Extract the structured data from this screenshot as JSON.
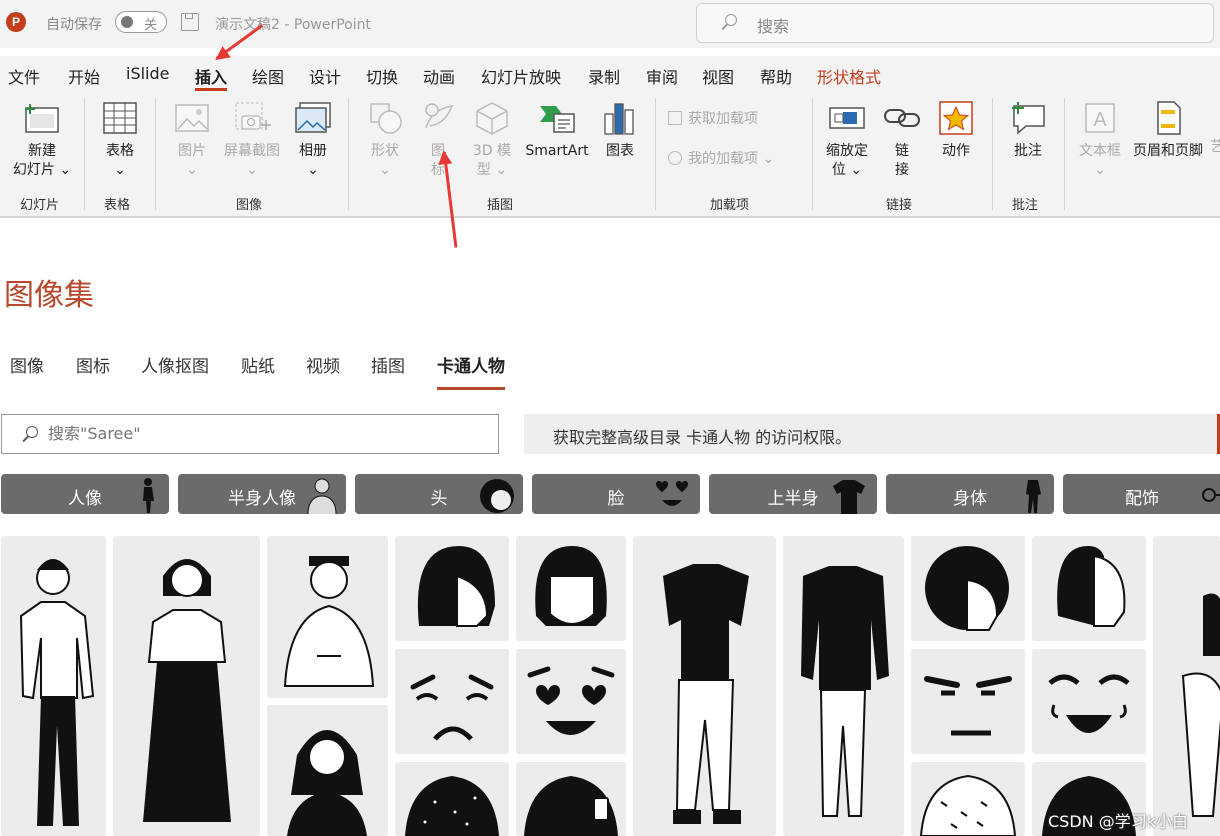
{
  "titlebar": {
    "logo": "P",
    "autosave_label": "自动保存",
    "autosave_state": "关",
    "document_title": "演示文稿2",
    "app_name": "PowerPoint",
    "search_placeholder": "搜索"
  },
  "menu": [
    "文件",
    "开始",
    "iSlide",
    "插入",
    "绘图",
    "设计",
    "切换",
    "动画",
    "幻灯片放映",
    "录制",
    "审阅",
    "视图",
    "帮助",
    "形状格式"
  ],
  "menu_active": "插入",
  "ribbon": {
    "new_slide": [
      "新建",
      "幻灯片 ⌄"
    ],
    "table": [
      "表格",
      "⌄"
    ],
    "picture": [
      "图片",
      "⌄"
    ],
    "screenshot": [
      "屏幕截图",
      "⌄"
    ],
    "album": [
      "相册",
      "⌄"
    ],
    "shapes": [
      "形状",
      "⌄"
    ],
    "icons": [
      "图",
      "标"
    ],
    "model3d": [
      "3D 模",
      "型 ⌄"
    ],
    "smartart": "SmartArt",
    "chart": "图表",
    "get_addins": "获取加载项",
    "my_addins": "我的加载项",
    "zoom": [
      "缩放定",
      "位 ⌄"
    ],
    "link": [
      "链",
      "接"
    ],
    "action": "动作",
    "comment": "批注",
    "textbox": [
      "文本框",
      "⌄"
    ],
    "header_footer": "页眉和页脚",
    "cut_char": "艺",
    "groups": [
      "幻灯片",
      "表格",
      "图像",
      "插图",
      "加载项",
      "链接",
      "批注"
    ]
  },
  "pane": {
    "title": "图像集",
    "tabs": [
      "图像",
      "图标",
      "人像抠图",
      "贴纸",
      "视频",
      "插图",
      "卡通人物"
    ],
    "active_tab": "卡通人物",
    "search_placeholder": "搜索\"Saree\"",
    "notice": "获取完整高级目录 卡通人物 的访问权限。",
    "categories": [
      "人像",
      "半身人像",
      "头",
      "脸",
      "上半身",
      "身体",
      "配饰"
    ]
  },
  "watermark": "CSDN @学习k小白",
  "colors": {
    "accent": "#c43e1c",
    "pane_accent": "#b7472a",
    "chip_bg": "#6b6b6b",
    "tile_bg": "#ececec",
    "arrow": "#e53935"
  }
}
